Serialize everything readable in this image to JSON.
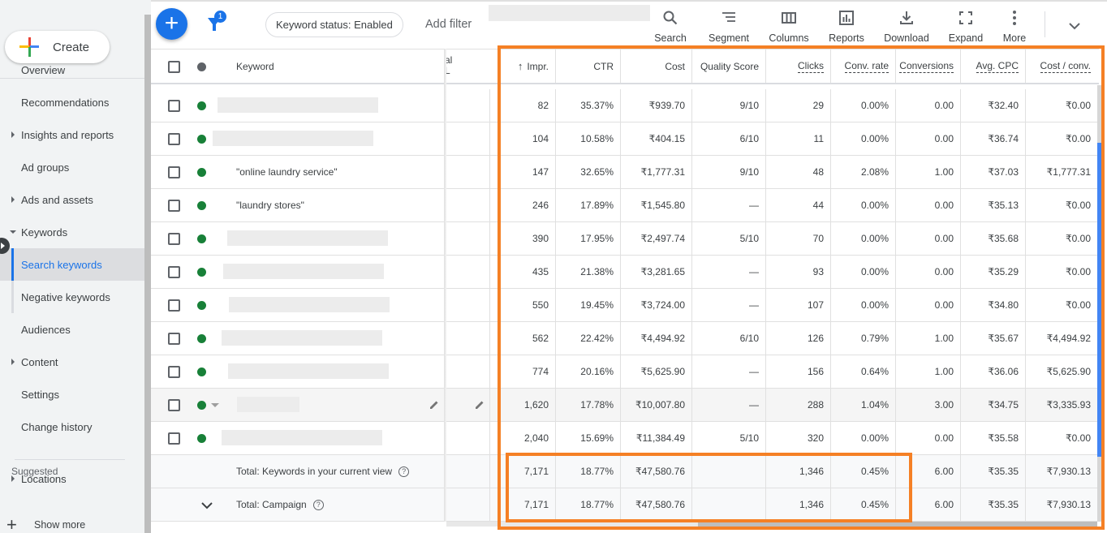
{
  "sidebar": {
    "create_label": "Create",
    "items": [
      {
        "label": "Overview",
        "expandable": false
      },
      {
        "label": "Recommendations",
        "expandable": false
      },
      {
        "label": "Insights and reports",
        "expandable": true
      },
      {
        "label": "Ad groups",
        "expandable": false
      },
      {
        "label": "Ads and assets",
        "expandable": true
      },
      {
        "label": "Keywords",
        "expandable": true,
        "expanded": true
      },
      {
        "label": "Search keywords",
        "sub": true,
        "active": true
      },
      {
        "label": "Negative keywords",
        "sub": true
      },
      {
        "label": "Audiences",
        "expandable": false
      },
      {
        "label": "Content",
        "expandable": true
      },
      {
        "label": "Settings",
        "expandable": false
      },
      {
        "label": "Change history",
        "expandable": false
      }
    ],
    "suggested_label": "Suggested",
    "suggested_items": [
      {
        "label": "Locations",
        "expandable": true
      }
    ],
    "show_more_label": "Show more"
  },
  "toolbar": {
    "filter_count": "1",
    "filter_chip": "Keyword status: Enabled",
    "add_filter": "Add filter",
    "tools": [
      {
        "label": "Search",
        "icon": "search-icon"
      },
      {
        "label": "Segment",
        "icon": "segment-icon"
      },
      {
        "label": "Columns",
        "icon": "columns-icon"
      },
      {
        "label": "Reports",
        "icon": "reports-icon"
      },
      {
        "label": "Download",
        "icon": "download-icon"
      },
      {
        "label": "Expand",
        "icon": "expand-icon"
      },
      {
        "label": "More",
        "icon": "more-vert-icon"
      }
    ]
  },
  "table": {
    "headers": {
      "keyword": "Keyword",
      "partial_col": "al\nL",
      "impr": "Impr.",
      "ctr": "CTR",
      "cost": "Cost",
      "quality_score": "Quality Score",
      "clicks": "Clicks",
      "conv_rate": "Conv. rate",
      "conversions": "Conversions",
      "avg_cpc": "Avg. CPC",
      "cost_conv": "Cost / conv."
    },
    "sort_indicator": "↑",
    "rows": [
      {
        "keyword": "",
        "redacted": true,
        "impr": "82",
        "ctr": "35.37%",
        "cost": "₹939.70",
        "qs": "9/10",
        "clicks": "29",
        "conv_rate": "0.00%",
        "conversions": "0.00",
        "avg_cpc": "₹32.40",
        "cost_conv": "₹0.00"
      },
      {
        "keyword": "",
        "redacted": true,
        "impr": "104",
        "ctr": "10.58%",
        "cost": "₹404.15",
        "qs": "6/10",
        "clicks": "11",
        "conv_rate": "0.00%",
        "conversions": "0.00",
        "avg_cpc": "₹36.74",
        "cost_conv": "₹0.00"
      },
      {
        "keyword": "\"online laundry service\"",
        "redacted": false,
        "impr": "147",
        "ctr": "32.65%",
        "cost": "₹1,777.31",
        "qs": "9/10",
        "clicks": "48",
        "conv_rate": "2.08%",
        "conversions": "1.00",
        "avg_cpc": "₹37.03",
        "cost_conv": "₹1,777.31"
      },
      {
        "keyword": "\"laundry stores\"",
        "redacted": false,
        "impr": "246",
        "ctr": "17.89%",
        "cost": "₹1,545.80",
        "qs": "—",
        "clicks": "44",
        "conv_rate": "0.00%",
        "conversions": "0.00",
        "avg_cpc": "₹35.13",
        "cost_conv": "₹0.00"
      },
      {
        "keyword": "",
        "redacted": true,
        "impr": "390",
        "ctr": "17.95%",
        "cost": "₹2,497.74",
        "qs": "5/10",
        "clicks": "70",
        "conv_rate": "0.00%",
        "conversions": "0.00",
        "avg_cpc": "₹35.68",
        "cost_conv": "₹0.00"
      },
      {
        "keyword": "",
        "redacted": true,
        "impr": "435",
        "ctr": "21.38%",
        "cost": "₹3,281.65",
        "qs": "—",
        "clicks": "93",
        "conv_rate": "0.00%",
        "conversions": "0.00",
        "avg_cpc": "₹35.29",
        "cost_conv": "₹0.00"
      },
      {
        "keyword": "",
        "redacted": true,
        "impr": "550",
        "ctr": "19.45%",
        "cost": "₹3,724.00",
        "qs": "—",
        "clicks": "107",
        "conv_rate": "0.00%",
        "conversions": "0.00",
        "avg_cpc": "₹34.80",
        "cost_conv": "₹0.00"
      },
      {
        "keyword": "",
        "redacted": true,
        "impr": "562",
        "ctr": "22.42%",
        "cost": "₹4,494.92",
        "qs": "6/10",
        "clicks": "126",
        "conv_rate": "0.79%",
        "conversions": "1.00",
        "avg_cpc": "₹35.67",
        "cost_conv": "₹4,494.92"
      },
      {
        "keyword": "",
        "redacted": true,
        "impr": "774",
        "ctr": "20.16%",
        "cost": "₹5,625.90",
        "qs": "—",
        "clicks": "156",
        "conv_rate": "0.64%",
        "conversions": "1.00",
        "avg_cpc": "₹36.06",
        "cost_conv": "₹5,625.90"
      },
      {
        "keyword": "",
        "redacted": true,
        "hovered": true,
        "impr": "1,620",
        "ctr": "17.78%",
        "cost": "₹10,007.80",
        "qs": "—",
        "clicks": "288",
        "conv_rate": "1.04%",
        "conversions": "3.00",
        "avg_cpc": "₹34.75",
        "cost_conv": "₹3,335.93"
      },
      {
        "keyword": "",
        "redacted": true,
        "impr": "2,040",
        "ctr": "15.69%",
        "cost": "₹11,384.49",
        "qs": "5/10",
        "clicks": "320",
        "conv_rate": "0.00%",
        "conversions": "0.00",
        "avg_cpc": "₹35.58",
        "cost_conv": "₹0.00"
      }
    ],
    "totals": [
      {
        "label": "Total: Keywords in your current view",
        "impr": "7,171",
        "ctr": "18.77%",
        "cost": "₹47,580.76",
        "qs": "",
        "clicks": "1,346",
        "conv_rate": "0.45%",
        "conversions": "6.00",
        "avg_cpc": "₹35.35",
        "cost_conv": "₹7,930.13"
      },
      {
        "label": "Total: Campaign",
        "impr": "7,171",
        "ctr": "18.77%",
        "cost": "₹47,580.76",
        "qs": "",
        "clicks": "1,346",
        "conv_rate": "0.45%",
        "conversions": "6.00",
        "avg_cpc": "₹35.35",
        "cost_conv": "₹7,930.13"
      }
    ]
  },
  "colors": {
    "accent": "#1a73e8",
    "status_enabled": "#188038",
    "highlight": "#f58025"
  }
}
